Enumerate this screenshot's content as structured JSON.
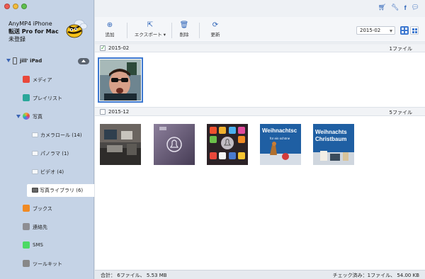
{
  "sidebar": {
    "brand_line1": "AnyMP4 iPhone",
    "brand_line2": "転送 Pro for Mac",
    "brand_line3": "未登録",
    "device": "jill' iPad",
    "items": [
      {
        "label": "メディア",
        "icon": "music-icon",
        "color": "#e9483b"
      },
      {
        "label": "プレイリスト",
        "icon": "playlist-icon",
        "color": "#2aa79a"
      },
      {
        "label": "写真",
        "icon": "photos-icon",
        "color": "#f2a93b"
      },
      {
        "label": "カメラロール (14)",
        "icon": "folder-icon"
      },
      {
        "label": "パノラマ (1)",
        "icon": "folder-icon"
      },
      {
        "label": "ビデオ (4)",
        "icon": "folder-icon"
      },
      {
        "label": "写真ライブラリ (6)",
        "icon": "photo-library-icon"
      },
      {
        "label": "ブックス",
        "icon": "books-icon",
        "color": "#f08a24"
      },
      {
        "label": "連絡先",
        "icon": "contacts-icon",
        "color": "#8e8e93"
      },
      {
        "label": "SMS",
        "icon": "sms-icon",
        "color": "#4cd964"
      },
      {
        "label": "ツールキット",
        "icon": "toolkit-icon",
        "color": "#888888"
      }
    ]
  },
  "toolbar": {
    "add": "追加",
    "export": "エクスポート",
    "delete": "削除",
    "refresh": "更新",
    "date_select": "2015-02"
  },
  "sections": [
    {
      "date": "2015-02",
      "count": "1ファイル",
      "checked": true
    },
    {
      "date": "2015-12",
      "count": "5ファイル",
      "checked": false
    }
  ],
  "thumb_texts": {
    "t4": "Weihnachtsc",
    "t4_sub": "für ein schöne",
    "t5_line1": "Weihnachts",
    "t5_line2": "Christbaum"
  },
  "status": {
    "left": "合計： 6ファイル、 5.53 MB",
    "right": "チェック済み：1ファイル、 54.00 KB"
  }
}
